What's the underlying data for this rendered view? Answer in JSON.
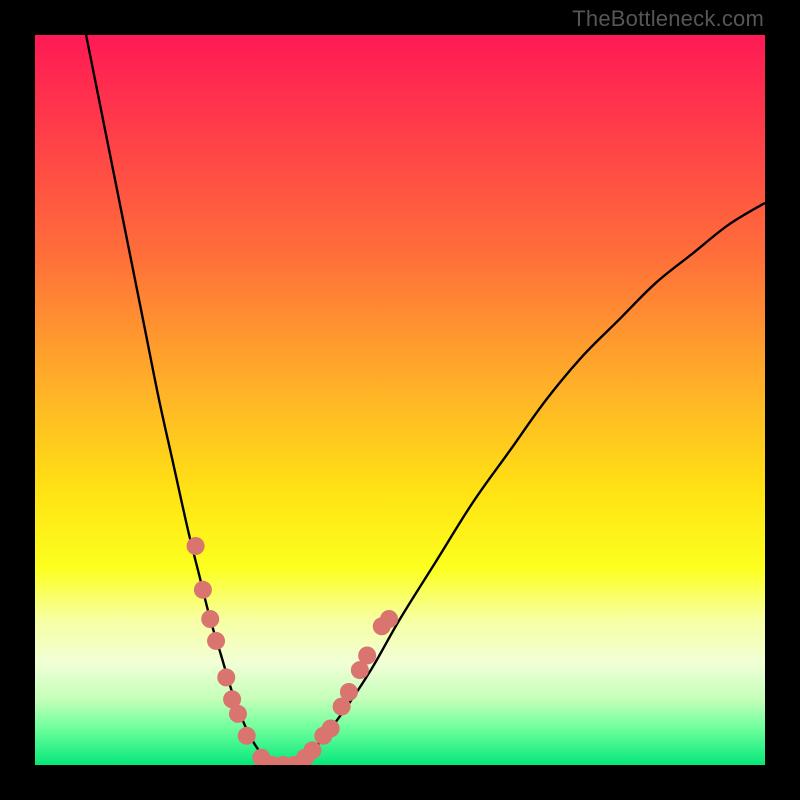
{
  "watermark": {
    "text": "TheBottleneck.com"
  },
  "chart_data": {
    "type": "line",
    "title": "",
    "xlabel": "",
    "ylabel": "",
    "xlim": [
      0,
      100
    ],
    "ylim": [
      0,
      100
    ],
    "gradient_stops": [
      {
        "pct": 0,
        "color": "#ff1a55"
      },
      {
        "pct": 12,
        "color": "#ff3a4a"
      },
      {
        "pct": 30,
        "color": "#ff6e3a"
      },
      {
        "pct": 50,
        "color": "#ffb726"
      },
      {
        "pct": 63,
        "color": "#ffe413"
      },
      {
        "pct": 73,
        "color": "#fcff1f"
      },
      {
        "pct": 80,
        "color": "#f7ffa1"
      },
      {
        "pct": 86,
        "color": "#f1ffd6"
      },
      {
        "pct": 91,
        "color": "#c4ffb9"
      },
      {
        "pct": 95,
        "color": "#6dff9c"
      },
      {
        "pct": 100,
        "color": "#05e87a"
      }
    ],
    "series": [
      {
        "name": "curve",
        "x": [
          7,
          9,
          11,
          13,
          15,
          17,
          19,
          21,
          22.5,
          24,
          25.5,
          27,
          28.5,
          30,
          31.5,
          33,
          35,
          38,
          42,
          46,
          50,
          55,
          60,
          65,
          70,
          75,
          80,
          85,
          90,
          95,
          100
        ],
        "y": [
          100,
          90,
          80,
          70,
          60,
          50,
          41,
          32,
          26,
          20,
          15,
          10,
          6,
          3,
          1,
          0,
          0,
          2,
          7,
          13,
          20,
          28,
          36,
          43,
          50,
          56,
          61,
          66,
          70,
          74,
          77
        ]
      }
    ],
    "markers": {
      "name": "data-points",
      "color": "#d9746f",
      "radius": 9,
      "points": [
        {
          "x": 22.0,
          "y": 30
        },
        {
          "x": 23.0,
          "y": 24
        },
        {
          "x": 24.0,
          "y": 20
        },
        {
          "x": 24.8,
          "y": 17
        },
        {
          "x": 26.2,
          "y": 12
        },
        {
          "x": 27.0,
          "y": 9
        },
        {
          "x": 27.8,
          "y": 7
        },
        {
          "x": 29.0,
          "y": 4
        },
        {
          "x": 31.0,
          "y": 1
        },
        {
          "x": 32.5,
          "y": 0
        },
        {
          "x": 34.0,
          "y": 0
        },
        {
          "x": 35.5,
          "y": 0
        },
        {
          "x": 37.0,
          "y": 1
        },
        {
          "x": 38.0,
          "y": 2
        },
        {
          "x": 39.5,
          "y": 4
        },
        {
          "x": 40.5,
          "y": 5
        },
        {
          "x": 42.0,
          "y": 8
        },
        {
          "x": 43.0,
          "y": 10
        },
        {
          "x": 44.5,
          "y": 13
        },
        {
          "x": 45.5,
          "y": 15
        },
        {
          "x": 47.5,
          "y": 19
        },
        {
          "x": 48.5,
          "y": 20
        }
      ]
    }
  }
}
